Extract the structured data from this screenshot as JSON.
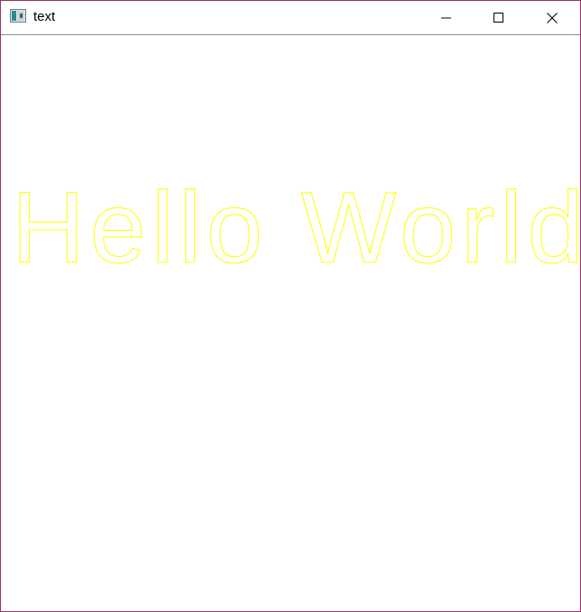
{
  "window": {
    "title": "text",
    "app_icon": "window-app-icon",
    "controls": {
      "minimize_icon": "minimize-icon",
      "maximize_icon": "maximize-icon",
      "close_icon": "close-icon"
    }
  },
  "canvas": {
    "text": "Hello World",
    "text_color": "#ffff00",
    "background": "#ffffff"
  }
}
